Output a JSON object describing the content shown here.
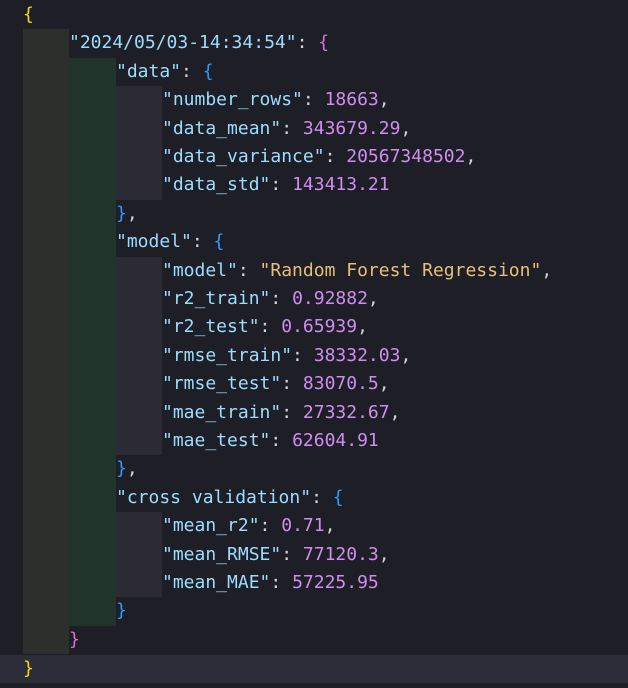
{
  "theme": {
    "background": "#1e1f26",
    "key_color": "#9cdcfe",
    "number_color": "#d08cf0",
    "string_color": "#e5c07b",
    "bracket_level1": "#ffd700",
    "bracket_level2": "#da70d6",
    "bracket_level3": "#2c9cff"
  },
  "json": {
    "open_brace": "{",
    "close_brace": "}",
    "run_key": "\"2024/05/03-14:34:54\"",
    "data": {
      "key": "\"data\"",
      "number_rows_key": "\"number_rows\"",
      "number_rows": "18663",
      "data_mean_key": "\"data_mean\"",
      "data_mean": "343679.29",
      "data_variance_key": "\"data_variance\"",
      "data_variance": "20567348502",
      "data_std_key": "\"data_std\"",
      "data_std": "143413.21"
    },
    "model": {
      "key": "\"model\"",
      "model_key": "\"model\"",
      "model": "\"Random Forest Regression\"",
      "r2_train_key": "\"r2_train\"",
      "r2_train": "0.92882",
      "r2_test_key": "\"r2_test\"",
      "r2_test": "0.65939",
      "rmse_train_key": "\"rmse_train\"",
      "rmse_train": "38332.03",
      "rmse_test_key": "\"rmse_test\"",
      "rmse_test": "83070.5",
      "mae_train_key": "\"mae_train\"",
      "mae_train": "27332.67",
      "mae_test_key": "\"mae_test\"",
      "mae_test": "62604.91"
    },
    "cross_validation": {
      "key": "\"cross validation\"",
      "mean_r2_key": "\"mean_r2\"",
      "mean_r2": "0.71",
      "mean_rmse_key": "\"mean_RMSE\"",
      "mean_rmse": "77120.3",
      "mean_mae_key": "\"mean_MAE\"",
      "mean_mae": "57225.95"
    }
  }
}
